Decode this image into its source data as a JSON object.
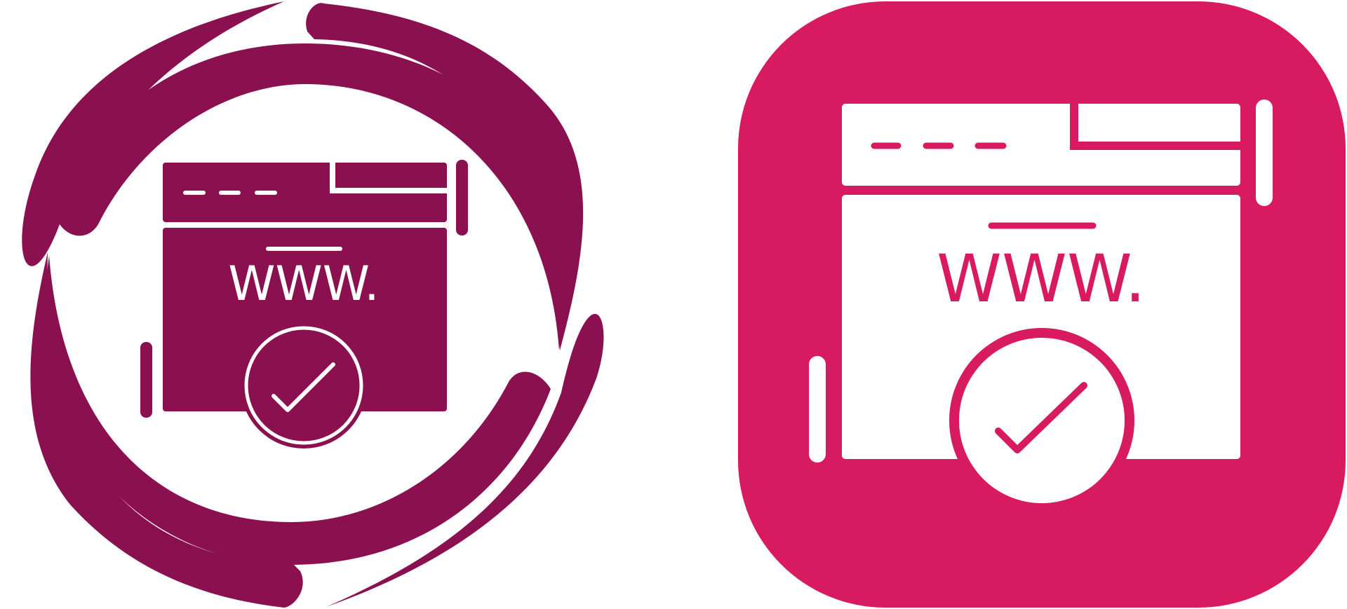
{
  "colors": {
    "left_primary": "#8a1050",
    "right_background": "#d81b60",
    "foreground_light": "#ffffff"
  },
  "icons": [
    {
      "name": "website-approved-circular-arrows-icon",
      "variant": "glyph-circular",
      "label": "WWW."
    },
    {
      "name": "website-approved-rounded-square-icon",
      "variant": "glyph-rounded-square",
      "label": "WWW."
    }
  ]
}
